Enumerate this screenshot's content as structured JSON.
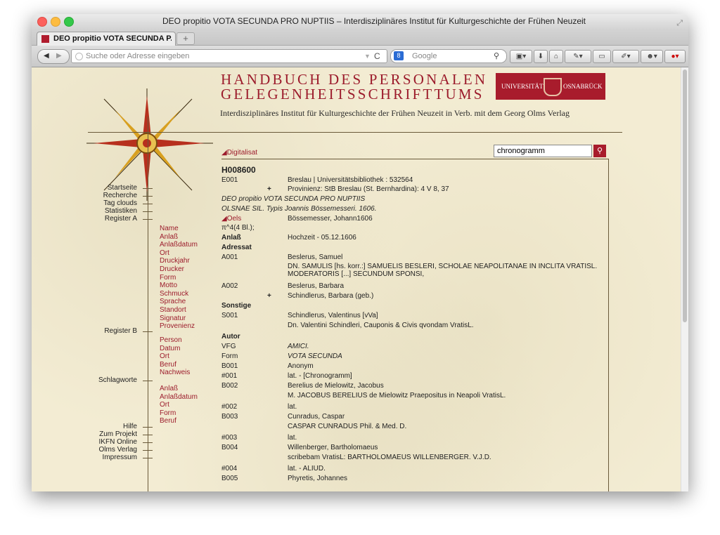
{
  "window": {
    "title": "DEO propitio VOTA SECUNDA PRO NUPTIIS – Interdisziplinäres Institut für Kulturgeschichte der Frühen Neuzeit"
  },
  "tab": {
    "label": "DEO propitio VOTA SECUNDA P...",
    "new_tab": "+"
  },
  "toolbar": {
    "back": "◀",
    "forward": "▶",
    "url_placeholder": "Suche oder Adresse eingeben",
    "reload": "C",
    "search_engine": "8",
    "search_placeholder": "Google"
  },
  "header": {
    "line1": "HANDBUCH DES PERSONALEN",
    "line2": "GELEGENHEITSSCHRIFTTUMS",
    "subtitle": "Interdisziplinäres Institut für Kulturgeschichte der Frühen Neuzeit in Verb. mit dem Georg Olms Verlag",
    "logo_left": "UNIVERSITÄT",
    "logo_right": "OSNABRÜCK"
  },
  "sidebar": {
    "main": [
      "Startseite",
      "Recherche",
      "Tag clouds",
      "Statistiken",
      "Register A"
    ],
    "register_a": [
      "Name",
      "Anlaß",
      "Anlaßdatum",
      "Ort",
      "Druckjahr",
      "Drucker",
      "Form",
      "Motto",
      "Schmuck",
      "Sprache",
      "Standort",
      "Signatur",
      "Provenienz"
    ],
    "register_b_label": "Register B",
    "register_b": [
      "Person",
      "Datum",
      "Ort",
      "Beruf",
      "Nachweis"
    ],
    "schlagworte_label": "Schlagworte",
    "schlagworte": [
      "Anlaß",
      "Anlaßdatum",
      "Ort",
      "Form",
      "Beruf"
    ],
    "footer": [
      "Hilfe",
      "Zum Projekt",
      "IKFN Online",
      "Olms Verlag",
      "Impressum"
    ]
  },
  "search": {
    "value": "chronogramm"
  },
  "record": {
    "digitalisat": "Digitalisat",
    "id": "H008600",
    "e001_label": "E001",
    "e001_value": "Breslau | Universitätsbibliothek : 532564",
    "provenienz": "Provinienz: StB Breslau (St. Bernhardina): 4 V 8, 37",
    "title": "DEO propitio VOTA SECUNDA PRO NUPTIIS",
    "imprint": "OLSNAE SIL. Typis Joannis Bössemesseri. 1606.",
    "place_link": "Oels",
    "printer": "Bössemesser, Johann1606",
    "collation": "π^4(4 Bl.);",
    "anlass_label": "Anlaß",
    "anlass_value": "Hochzeit - 05.12.1606",
    "adressat_label": "Adressat",
    "a001_label": "A001",
    "a001_name": "Beslerus, Samuel",
    "a001_text": "DN. SAMULIS [hs. korr.:] SAMUELIS BESLERI, SCHOLAE NEAPOLITANAE IN INCLITA VRATISL. MODERATORIS [...] SECUNDUM SPONSI,",
    "a002_label": "A002",
    "a002_name": "Beslerus, Barbara",
    "a002_plus": "Schindlerus, Barbara (geb.)",
    "sonstige_label": "Sonstige",
    "s001_label": "S001",
    "s001_name": "Schindlerus, Valentinus [vVa]",
    "s001_text": "Dn. Valentini Schindleri, Cauponis & Civis qvondam VratisL.",
    "autor_label": "Autor",
    "vfg_label": "VFG",
    "vfg_value": "AMICI.",
    "form_label": "Form",
    "form_value": "VOTA SECUNDA",
    "b001_label": "B001",
    "b001_value": "Anonym",
    "n001_label": "#001",
    "n001_value": "lat. - [Chronogramm]",
    "b002_label": "B002",
    "b002_name": "Berelius de Mielowitz, Jacobus",
    "b002_text": "M. JACOBUS BERELIUS de Mielowitz Praepositus in Neapoli VratisL.",
    "n002_label": "#002",
    "n002_value": "lat.",
    "b003_label": "B003",
    "b003_name": "Cunradus, Caspar",
    "b003_text": "CASPAR CUNRADUS Phil. & Med. D.",
    "n003_label": "#003",
    "n003_value": "lat.",
    "b004_label": "B004",
    "b004_name": "Willenberger, Bartholomaeus",
    "b004_text": "scribebam VratisL: BARTHOLOMAEUS WILLENBERGER. V.J.D.",
    "n004_label": "#004",
    "n004_value": "lat. - ALIUD.",
    "b005_label": "B005",
    "b005_name": "Phyretis, Johannes"
  },
  "colors": {
    "accent": "#9c1c2c",
    "paper": "#f3ecd3",
    "line": "#6a5a3a"
  }
}
